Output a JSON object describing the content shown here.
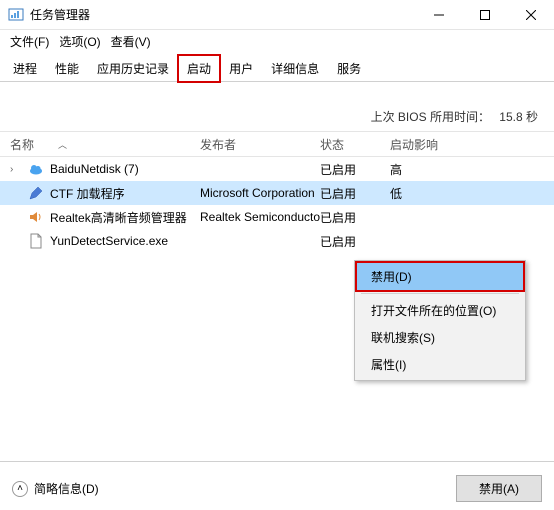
{
  "window": {
    "title": "任务管理器"
  },
  "menu": {
    "file": "文件(F)",
    "options": "选项(O)",
    "view": "查看(V)"
  },
  "tabs": {
    "items": [
      "进程",
      "性能",
      "应用历史记录",
      "启动",
      "用户",
      "详细信息",
      "服务"
    ],
    "active_index": 3
  },
  "bios": {
    "label": "上次 BIOS 所用时间：",
    "value": "15.8 秒"
  },
  "columns": {
    "name": "名称",
    "publisher": "发布者",
    "status": "状态",
    "impact": "启动影响"
  },
  "rows": [
    {
      "expandable": true,
      "icon": "cloud-icon",
      "name": "BaiduNetdisk (7)",
      "publisher": "",
      "status": "已启用",
      "impact": "高"
    },
    {
      "expandable": false,
      "icon": "pen-icon",
      "name": "CTF 加载程序",
      "publisher": "Microsoft Corporation",
      "status": "已启用",
      "impact": "低",
      "selected": true
    },
    {
      "expandable": false,
      "icon": "speaker-icon",
      "name": "Realtek高清晰音频管理器",
      "publisher": "Realtek Semiconductor",
      "status": "已启用",
      "impact": ""
    },
    {
      "expandable": false,
      "icon": "file-icon",
      "name": "YunDetectService.exe",
      "publisher": "",
      "status": "已启用",
      "impact": ""
    }
  ],
  "context_menu": {
    "disable": "禁用(D)",
    "open_location": "打开文件所在的位置(O)",
    "search_online": "联机搜索(S)",
    "properties": "属性(I)"
  },
  "footer": {
    "fewer": "简略信息(D)",
    "disable_btn": "禁用(A)"
  }
}
